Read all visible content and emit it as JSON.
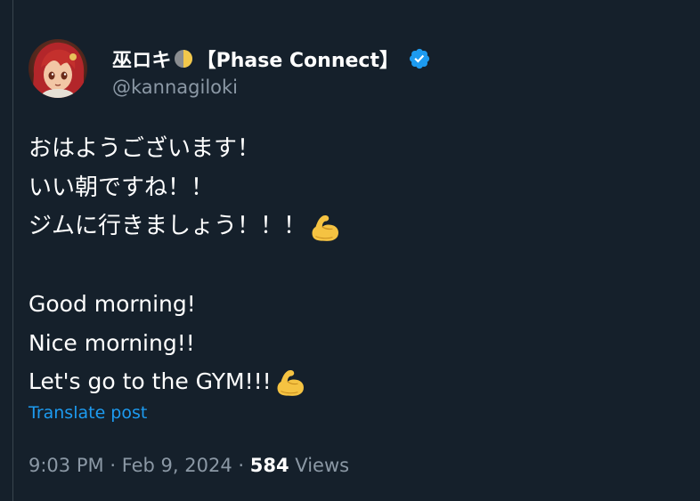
{
  "author": {
    "display_name": "巫ロキ",
    "affiliation": "【Phase Connect】",
    "handle": "@kannagiloki",
    "emoji_name": "last-quarter-moon-icon",
    "verified_color": "#1d9bf0"
  },
  "tweet": {
    "lines_jp": [
      "おはようございます！",
      "いい朝ですね！！",
      "ジムに行きましょう！！！"
    ],
    "lines_en": [
      "Good morning!",
      "Nice morning!!",
      "Let's go to the GYM!!!"
    ],
    "emoji": "flexed-biceps-icon"
  },
  "translate_label": "Translate post",
  "meta": {
    "time": "9:03 PM",
    "separator": "·",
    "date": "Feb 9, 2024",
    "views_count": "584",
    "views_label": "Views"
  },
  "colors": {
    "background": "#15202b",
    "text": "#ffffff",
    "muted": "#8b98a5",
    "link": "#1d9bf0"
  }
}
